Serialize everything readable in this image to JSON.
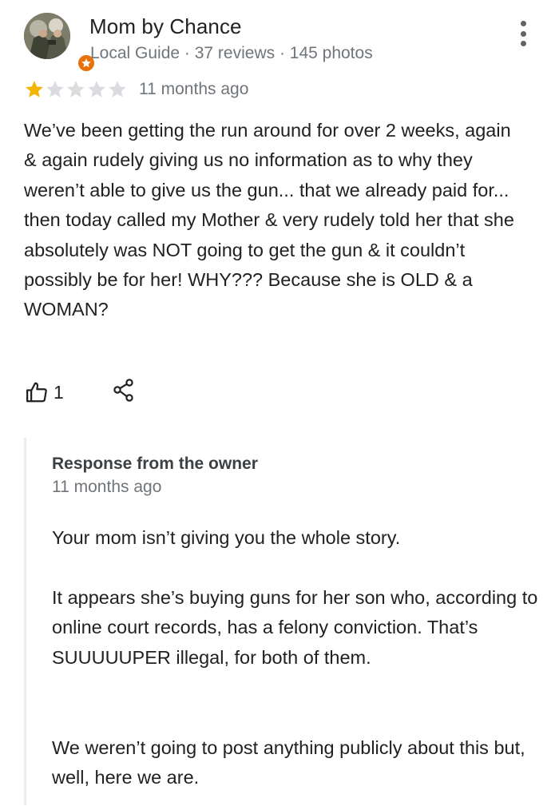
{
  "reviewer": {
    "name": "Mom by Chance",
    "meta": "Local Guide · 37 reviews · 145 photos"
  },
  "rating": {
    "stars": 1,
    "max": 5
  },
  "review": {
    "date": "11 months ago",
    "text": "We’ve been getting the run around for over 2 weeks, again & again rudely giving us no information as to why they weren’t able to give us the gun... that we already paid for... then today called my Mother & very rudely told her that she absolutely was NOT going to get the gun & it couldn’t possibly be for her! WHY??? Because she is OLD & a WOMAN?",
    "likes": "1"
  },
  "owner_response": {
    "title": "Response from the owner",
    "date": "11 months ago",
    "paragraphs": [
      "Your mom isn’t giving you the whole story.",
      "It appears she’s buying guns for her son who, according to online court records, has a felony conviction. That’s SUUUUUPER illegal, for both of them.",
      "We weren’t going to post anything publicly about this but, well, here we are."
    ]
  },
  "icons": {
    "more": "more-vert-icon",
    "like": "thumb-up-icon",
    "share": "share-icon",
    "badge": "local-guide-star-icon"
  },
  "colors": {
    "star_filled": "#f4b400",
    "star_empty": "#dadce0",
    "badge": "#e8710a",
    "meta_text": "#70757a"
  }
}
